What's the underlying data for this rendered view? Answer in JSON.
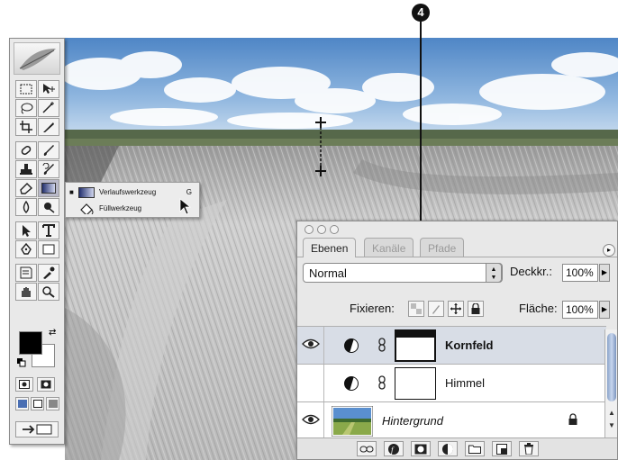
{
  "step_marker": "4",
  "flyout": {
    "items": [
      {
        "label": "Verlaufswerkzeug",
        "shortcut": "G",
        "selected": true
      },
      {
        "label": "Füllwerkzeug",
        "shortcut": "",
        "selected": false
      }
    ]
  },
  "layers_panel": {
    "tabs": [
      "Ebenen",
      "Kanäle",
      "Pfade"
    ],
    "active_tab": "Ebenen",
    "blend_mode": "Normal",
    "opacity_label": "Deckkr.:",
    "opacity_value": "100%",
    "lock_label": "Fixieren:",
    "fill_label": "Fläche:",
    "fill_value": "100%",
    "layers": [
      {
        "name": "Kornfeld",
        "visible": true,
        "selected": true,
        "italic": false
      },
      {
        "name": "Himmel",
        "visible": false,
        "selected": false,
        "italic": false
      },
      {
        "name": "Hintergrund",
        "visible": true,
        "selected": false,
        "italic": true,
        "locked": true
      }
    ]
  },
  "colors": {
    "foreground": "#000000",
    "background": "#ffffff",
    "selection_row": "#d8dde6"
  }
}
